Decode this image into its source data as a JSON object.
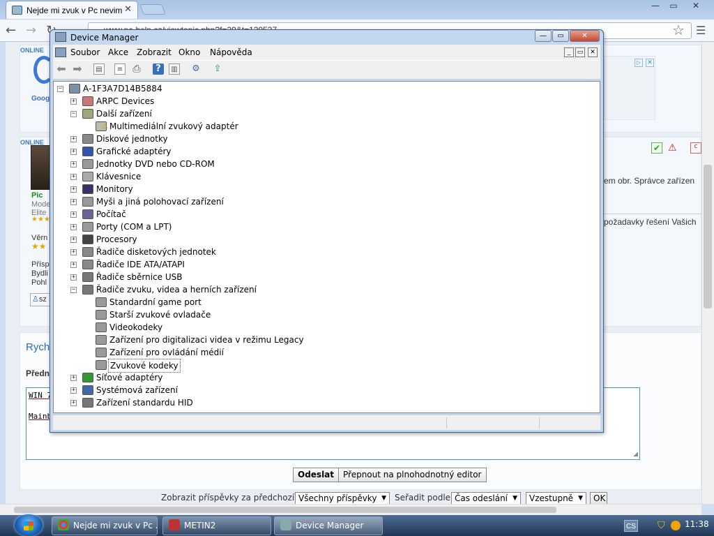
{
  "browser": {
    "tab_title": "Nejde mi zvuk v Pc nevim",
    "tab_close": "✕",
    "url": "www.pc-help.cz/viewtopic.php?f=29&t=129537",
    "window_buttons": [
      "—",
      "▭",
      "✕"
    ],
    "nav": {
      "back": "←",
      "forward": "→",
      "reload": "↻"
    },
    "star_icon": "☆",
    "wrench_icon": "☰"
  },
  "webpage": {
    "online_badge": "ONLINE",
    "online_badge2": "ONLINE",
    "ad_close": "✕",
    "user_name": "Pic",
    "user_role": "Mode",
    "user_rank": "Elite",
    "loyalty_label": "Věrn",
    "profile_lines": [
      "Přísp",
      "Bydli",
      "Pohl"
    ],
    "user_button": "sz",
    "post_text_1": "em obr. Správce zařízen",
    "post_text_2": "požadavky řešení Vašich",
    "quick_reply_title": "Rych",
    "preview_label": "Předn",
    "editor_lines": [
      "WIN 7",
      "Mainb"
    ],
    "send_button": "Odeslat",
    "switch_editor_button": "Přepnout na plnohodnotný editor",
    "filter_label": "Zobrazit příspěvky za předchozí:",
    "filter_value": "Všechny příspěvky",
    "sort_label": "Seřadit podle",
    "sort_value": "Čas odeslání",
    "order_value": "Vzestupně",
    "ok_button": "OK"
  },
  "device_manager": {
    "title": "Device Manager",
    "caption_buttons": [
      "—",
      "▭",
      "✕"
    ],
    "menu": [
      "Soubor",
      "Akce",
      "Zobrazit",
      "Okno",
      "Nápověda"
    ],
    "mdi_buttons": [
      "_",
      "▭",
      "✕"
    ],
    "root": "A-1F3A7D14B5884",
    "tree": [
      {
        "label": "ARPC Devices",
        "expanded": false,
        "icon": "arpc-icon"
      },
      {
        "label": "Další zařízení",
        "expanded": true,
        "icon": "unknown-device-icon",
        "children": [
          "Multimediální zvukový adaptér"
        ]
      },
      {
        "label": "Diskové jednotky",
        "expanded": false,
        "icon": "disk-icon"
      },
      {
        "label": "Grafické adaptéry",
        "expanded": false,
        "icon": "display-adapter-icon"
      },
      {
        "label": "Jednotky DVD nebo CD-ROM",
        "expanded": false,
        "icon": "dvd-icon"
      },
      {
        "label": "Klávesnice",
        "expanded": false,
        "icon": "keyboard-icon"
      },
      {
        "label": "Monitory",
        "expanded": false,
        "icon": "monitor-icon"
      },
      {
        "label": "Myši a jiná polohovací zařízení",
        "expanded": false,
        "icon": "mouse-icon"
      },
      {
        "label": "Počítač",
        "expanded": false,
        "icon": "computer-icon"
      },
      {
        "label": "Porty (COM a LPT)",
        "expanded": false,
        "icon": "port-icon"
      },
      {
        "label": "Procesory",
        "expanded": false,
        "icon": "cpu-icon"
      },
      {
        "label": "Řadiče disketových jednotek",
        "expanded": false,
        "icon": "floppy-controller-icon"
      },
      {
        "label": "Řadiče IDE ATA/ATAPI",
        "expanded": false,
        "icon": "ide-controller-icon"
      },
      {
        "label": "Řadiče sběrnice USB",
        "expanded": false,
        "icon": "usb-icon"
      },
      {
        "label": "Řadiče zvuku, videa a herních zařízení",
        "expanded": true,
        "icon": "sound-icon",
        "children": [
          "Standardní game port",
          "Starší zvukové ovladače",
          "Videokodeky",
          "Zařízení pro digitalizaci videa v režimu Legacy",
          "Zařízení pro ovládání médií",
          "Zvukové kodeky"
        ]
      },
      {
        "label": "Síťové adaptéry",
        "expanded": false,
        "icon": "network-icon"
      },
      {
        "label": "Systémová zařízení",
        "expanded": false,
        "icon": "system-icon"
      },
      {
        "label": "Zařízení standardu HID",
        "expanded": false,
        "icon": "hid-icon"
      }
    ],
    "selected": "Zvukové kodeky"
  },
  "taskbar": {
    "items": [
      "Nejde mi zvuk v Pc ...",
      "METIN2",
      "Device Manager"
    ],
    "lang": "CS",
    "clock": "11:38"
  }
}
